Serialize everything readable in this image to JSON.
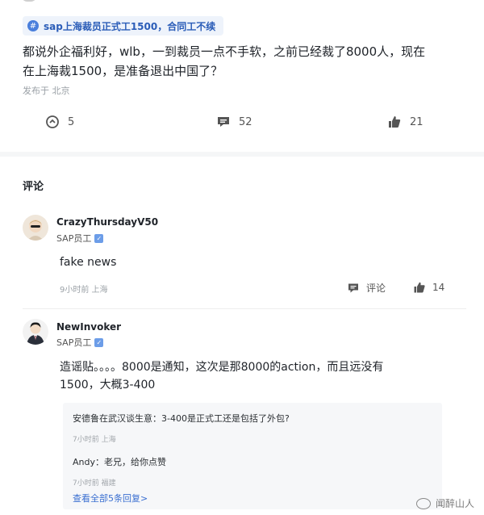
{
  "post": {
    "topic": "sap上海裁员正式工1500，合同工不续",
    "body_line1": "都说外企福利好，wlb，一到裁员一点不手软，之前已经裁了8000人，现在",
    "body_line2": "在上海裁1500，是准备退出中国了？",
    "meta": "发布于 北京",
    "actions": {
      "share_count": "5",
      "comment_count": "52",
      "like_count": "21"
    }
  },
  "comments_section": {
    "title": "评论"
  },
  "comments": [
    {
      "name": "CrazyThursdayV50",
      "role": "SAP员工",
      "text": "fake news",
      "meta": "9小时前 上海",
      "reply_label": "评论",
      "like_count": "14"
    },
    {
      "name": "NewInvoker",
      "role": "SAP员工",
      "text_line1": "造谣贴。。。。8000是通知，这次是那8000的action，而且远没有",
      "text_line2": "1500，大概3-400",
      "replies": [
        {
          "author": "安德鲁在武汉谈生意",
          "text": "：3-400是正式工还是包括了外包?",
          "meta": "7小时前 上海"
        },
        {
          "author": "Andy",
          "text": "：老兄，给你点赞",
          "meta": "7小时前 福建"
        }
      ],
      "view_all": "查看全部5条回复>"
    }
  ],
  "watermark": "闻醉山人"
}
